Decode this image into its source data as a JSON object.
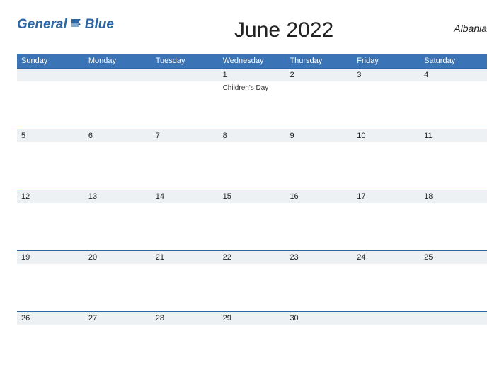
{
  "logo": {
    "text": "General",
    "suffix": "Blue"
  },
  "title": "June 2022",
  "country": "Albania",
  "weekdays": [
    "Sunday",
    "Monday",
    "Tuesday",
    "Wednesday",
    "Thursday",
    "Friday",
    "Saturday"
  ],
  "weeks": [
    [
      {
        "day": "",
        "event": ""
      },
      {
        "day": "",
        "event": ""
      },
      {
        "day": "",
        "event": ""
      },
      {
        "day": "1",
        "event": "Children's Day"
      },
      {
        "day": "2",
        "event": ""
      },
      {
        "day": "3",
        "event": ""
      },
      {
        "day": "4",
        "event": ""
      }
    ],
    [
      {
        "day": "5",
        "event": ""
      },
      {
        "day": "6",
        "event": ""
      },
      {
        "day": "7",
        "event": ""
      },
      {
        "day": "8",
        "event": ""
      },
      {
        "day": "9",
        "event": ""
      },
      {
        "day": "10",
        "event": ""
      },
      {
        "day": "11",
        "event": ""
      }
    ],
    [
      {
        "day": "12",
        "event": ""
      },
      {
        "day": "13",
        "event": ""
      },
      {
        "day": "14",
        "event": ""
      },
      {
        "day": "15",
        "event": ""
      },
      {
        "day": "16",
        "event": ""
      },
      {
        "day": "17",
        "event": ""
      },
      {
        "day": "18",
        "event": ""
      }
    ],
    [
      {
        "day": "19",
        "event": ""
      },
      {
        "day": "20",
        "event": ""
      },
      {
        "day": "21",
        "event": ""
      },
      {
        "day": "22",
        "event": ""
      },
      {
        "day": "23",
        "event": ""
      },
      {
        "day": "24",
        "event": ""
      },
      {
        "day": "25",
        "event": ""
      }
    ],
    [
      {
        "day": "26",
        "event": ""
      },
      {
        "day": "27",
        "event": ""
      },
      {
        "day": "28",
        "event": ""
      },
      {
        "day": "29",
        "event": ""
      },
      {
        "day": "30",
        "event": ""
      },
      {
        "day": "",
        "event": ""
      },
      {
        "day": "",
        "event": ""
      }
    ]
  ]
}
